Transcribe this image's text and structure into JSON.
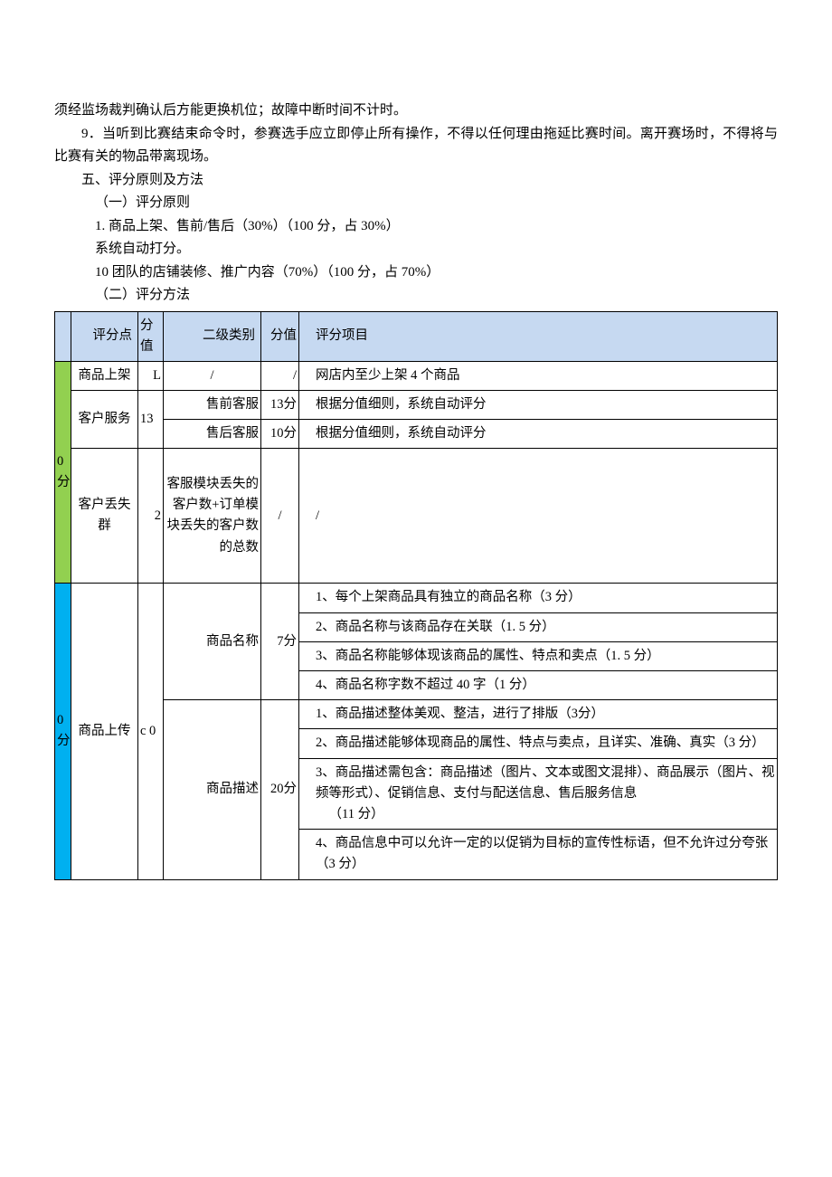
{
  "paragraphs": {
    "p1": "须经监场裁判确认后方能更换机位；故障中断时间不计时。",
    "p2": "9．当听到比赛结束命令时，参赛选手应立即停止所有操作，不得以任何理由拖延比赛时间。离开赛场时，不得将与比赛有关的物品带离现场。",
    "p3": "五、评分原则及方法",
    "p4": "（一）评分原则",
    "p5": "1. 商品上架、售前/售后（30%）（100 分，占 30%）",
    "p6": "系统自动打分。",
    "p7": "10    团队的店铺装修、推广内容（70%）（100 分，占 70%）",
    "p8": "（二）评分方法"
  },
  "headers": {
    "h0": "",
    "h1": "评分点",
    "h2": "分值",
    "h3": "二级类别",
    "h4": "分值",
    "h5": "评分项目"
  },
  "section1": {
    "label": "0分",
    "r1": {
      "pf": "商品上架",
      "fv": "L",
      "cat": "/",
      "val": "/",
      "item": "网店内至少上架 4 个商品"
    },
    "r2": {
      "pf": "客户服务",
      "fv": "13",
      "cat1": "售前客服",
      "val1": "13分",
      "item1": "根据分值细则，系统自动评分",
      "cat2": "售后客服",
      "val2": "10分",
      "item2": "根据分值细则，系统自动评分"
    },
    "r3": {
      "pf": "客户丢失群",
      "fv": "2",
      "cat": "客服模块丢失的客户数+订单模块丢失的客户数的总数",
      "val": "/",
      "item": "/"
    }
  },
  "section2": {
    "label": "0分",
    "r1": {
      "pf": "商品上传",
      "fv": "c 0",
      "cat1": "商品名称",
      "val1": "7分",
      "items1": {
        "a": "1、每个上架商品具有独立的商品名称（3 分）",
        "b": "2、商品名称与该商品存在关联（1. 5 分）",
        "c": "3、商品名称能够体现该商品的属性、特点和卖点（1. 5 分）",
        "d": "4、商品名称字数不超过 40 字（1 分）"
      },
      "cat2": "商品描述",
      "val2": "20分",
      "items2": {
        "a": "1、商品描述整体美观、整洁，进行了排版（3分）",
        "b": "2、商品描述能够体现商品的属性、特点与卖点，且详实、准确、真实（3 分）",
        "c": "3、商品描述需包含：商品描述（图片、文本或图文混排）、商品展示（图片、视频等形式）、促销信息、支付与配送信息、售后服务信息\n    （11 分）",
        "d": "4、商品信息中可以允许一定的以促销为目标的宣传性标语，但不允许过分夸张（3 分）"
      }
    }
  }
}
